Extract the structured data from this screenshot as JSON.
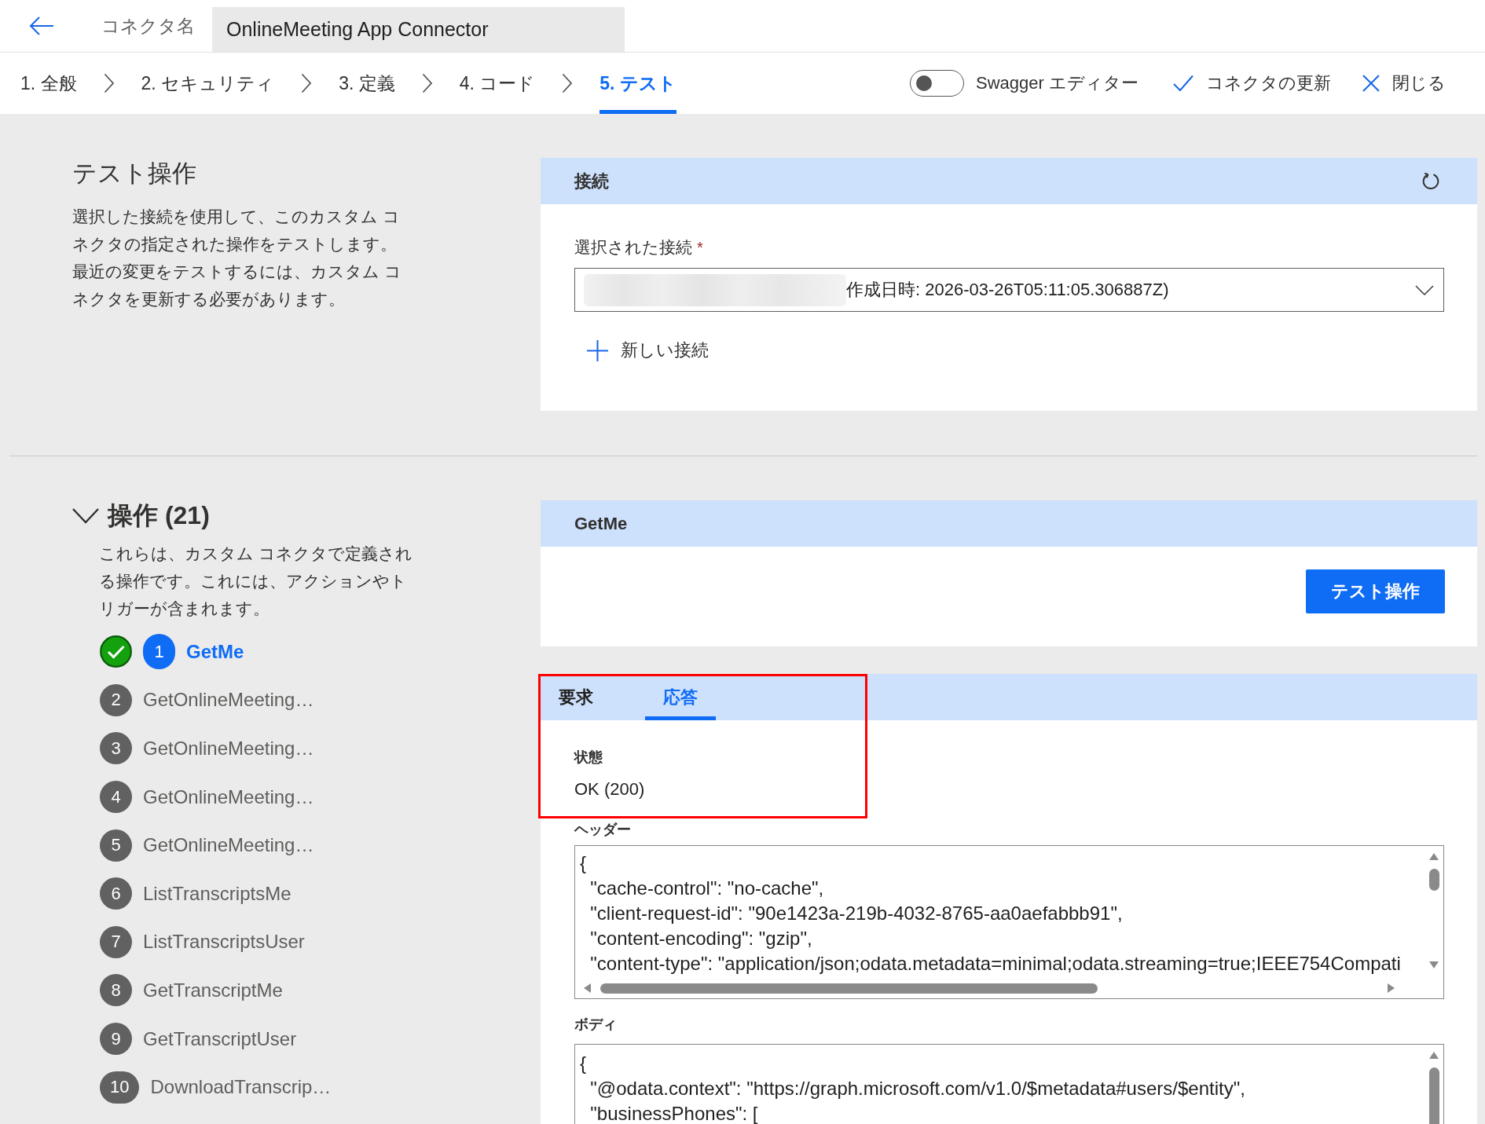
{
  "top_bar": {
    "name_label": "コネクタ名",
    "name_value": "OnlineMeeting App Connector"
  },
  "steps": [
    {
      "label": "1. 全般",
      "selected": false
    },
    {
      "label": "2. セキュリティ",
      "selected": false
    },
    {
      "label": "3. 定義",
      "selected": false
    },
    {
      "label": "4. コード",
      "selected": false
    },
    {
      "label": "5. テスト",
      "selected": true
    }
  ],
  "toolbar": {
    "swagger_editor": {
      "label": "Swagger エディター",
      "on": false
    },
    "update_button": "コネクタの更新",
    "close_button": "閉じる"
  },
  "test_intro": {
    "title": "テスト操作",
    "paragraphs": [
      "選択した接続を使用して、このカスタム コネクタの指定された操作をテストします。",
      "最近の変更をテストするには、カスタム コネクタを更新する必要があります。"
    ]
  },
  "connection_card": {
    "title": "接続",
    "field_label": "選択された接続",
    "required_mark": "*",
    "selected_value": "作成日時: 2026-03-26T05:11:05.306887Z)",
    "new_connection_button": "新しい接続"
  },
  "operations": {
    "title": "操作 (21)",
    "expanded": true,
    "description": "これらは、カスタム コネクタで定義される操作です。これには、アクションやトリガーが含まれます。",
    "items": [
      {
        "number": "1",
        "name": "GetMe",
        "selected": true,
        "tested": true
      },
      {
        "number": "2",
        "name": "GetOnlineMeeting…",
        "selected": false,
        "tested": false
      },
      {
        "number": "3",
        "name": "GetOnlineMeeting…",
        "selected": false,
        "tested": false
      },
      {
        "number": "4",
        "name": "GetOnlineMeeting…",
        "selected": false,
        "tested": false
      },
      {
        "number": "5",
        "name": "GetOnlineMeeting…",
        "selected": false,
        "tested": false
      },
      {
        "number": "6",
        "name": "ListTranscriptsMe",
        "selected": false,
        "tested": false
      },
      {
        "number": "7",
        "name": "ListTranscriptsUser",
        "selected": false,
        "tested": false
      },
      {
        "number": "8",
        "name": "GetTranscriptMe",
        "selected": false,
        "tested": false
      },
      {
        "number": "9",
        "name": "GetTranscriptUser",
        "selected": false,
        "tested": false
      },
      {
        "number": "10",
        "name": "DownloadTranscrip…",
        "selected": false,
        "tested": false
      }
    ]
  },
  "operation_card": {
    "title": "GetMe",
    "test_button": "テスト操作"
  },
  "result_card": {
    "highlighted": true,
    "tabs": [
      {
        "label": "要求",
        "selected": false
      },
      {
        "label": "応答",
        "selected": true
      }
    ],
    "status_label": "状態",
    "status_value": "OK (200)",
    "headers_label": "ヘッダー",
    "headers_lines": [
      "{",
      "  \"cache-control\": \"no-cache\",",
      "  \"client-request-id\": \"90e1423a-219b-4032-8765-aa0aefabbb91\",",
      "  \"content-encoding\": \"gzip\",",
      "  \"content-type\": \"application/json;odata.metadata=minimal;odata.streaming=true;IEEE754Compati"
    ],
    "body_label": "ボディ",
    "body_lines": [
      "{",
      "  \"@odata.context\": \"https://graph.microsoft.com/v1.0/$metadata#users/$entity\",",
      "  \"businessPhones\": ["
    ]
  }
}
